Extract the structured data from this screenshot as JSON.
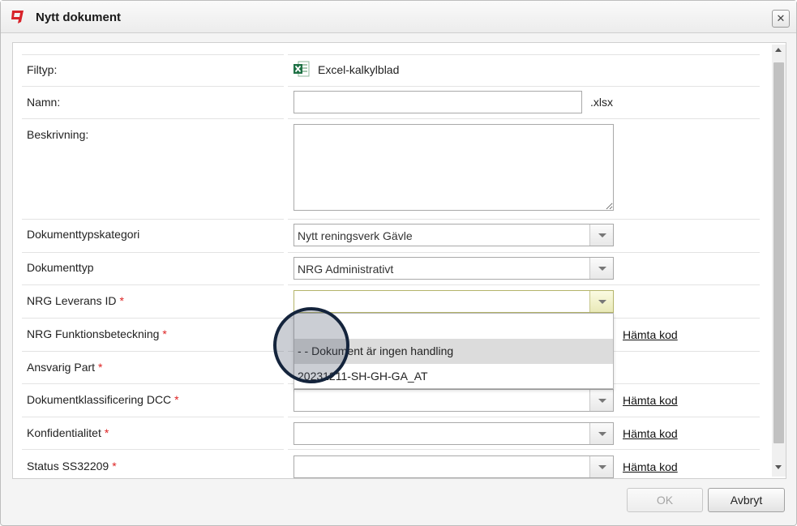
{
  "window": {
    "title": "Nytt dokument",
    "close_symbol": "✕"
  },
  "form": {
    "filetype": {
      "label": "Filtyp:",
      "value": "Excel-kalkylblad",
      "icon": "excel-icon"
    },
    "name": {
      "label": "Namn:",
      "value": "",
      "extension": ".xlsx"
    },
    "description": {
      "label": "Beskrivning:",
      "value": ""
    },
    "doc_type_category": {
      "label": "Dokumenttypskategori",
      "value": "Nytt reningsverk Gävle"
    },
    "doc_type": {
      "label": "Dokumenttyp",
      "value": "NRG Administrativt"
    },
    "delivery_id": {
      "label": "NRG Leverans ID",
      "required": "*",
      "value": ""
    },
    "function_code": {
      "label": "NRG Funktionsbeteckning",
      "required": "*",
      "link": "Hämta kod"
    },
    "responsible_party": {
      "label": "Ansvarig Part",
      "required": "*"
    },
    "doc_classification": {
      "label": "Dokumentklassificering DCC",
      "required": "*",
      "value": "",
      "link": "Hämta kod"
    },
    "confidentiality": {
      "label": "Konfidentialitet",
      "required": "*",
      "value": "",
      "link": "Hämta kod"
    },
    "status": {
      "label": "Status SS32209",
      "required": "*",
      "value": "",
      "link": "Hämta kod"
    }
  },
  "dropdown": {
    "options": [
      "- - Dokument är ingen handling",
      "20231211-SH-GH-GA_AT"
    ],
    "highlighted_index": 0
  },
  "buttons": {
    "ok": "OK",
    "cancel": "Avbryt"
  },
  "colors": {
    "required": "#dd2222",
    "logo": "#d8232a",
    "excel": "#1e7145"
  }
}
